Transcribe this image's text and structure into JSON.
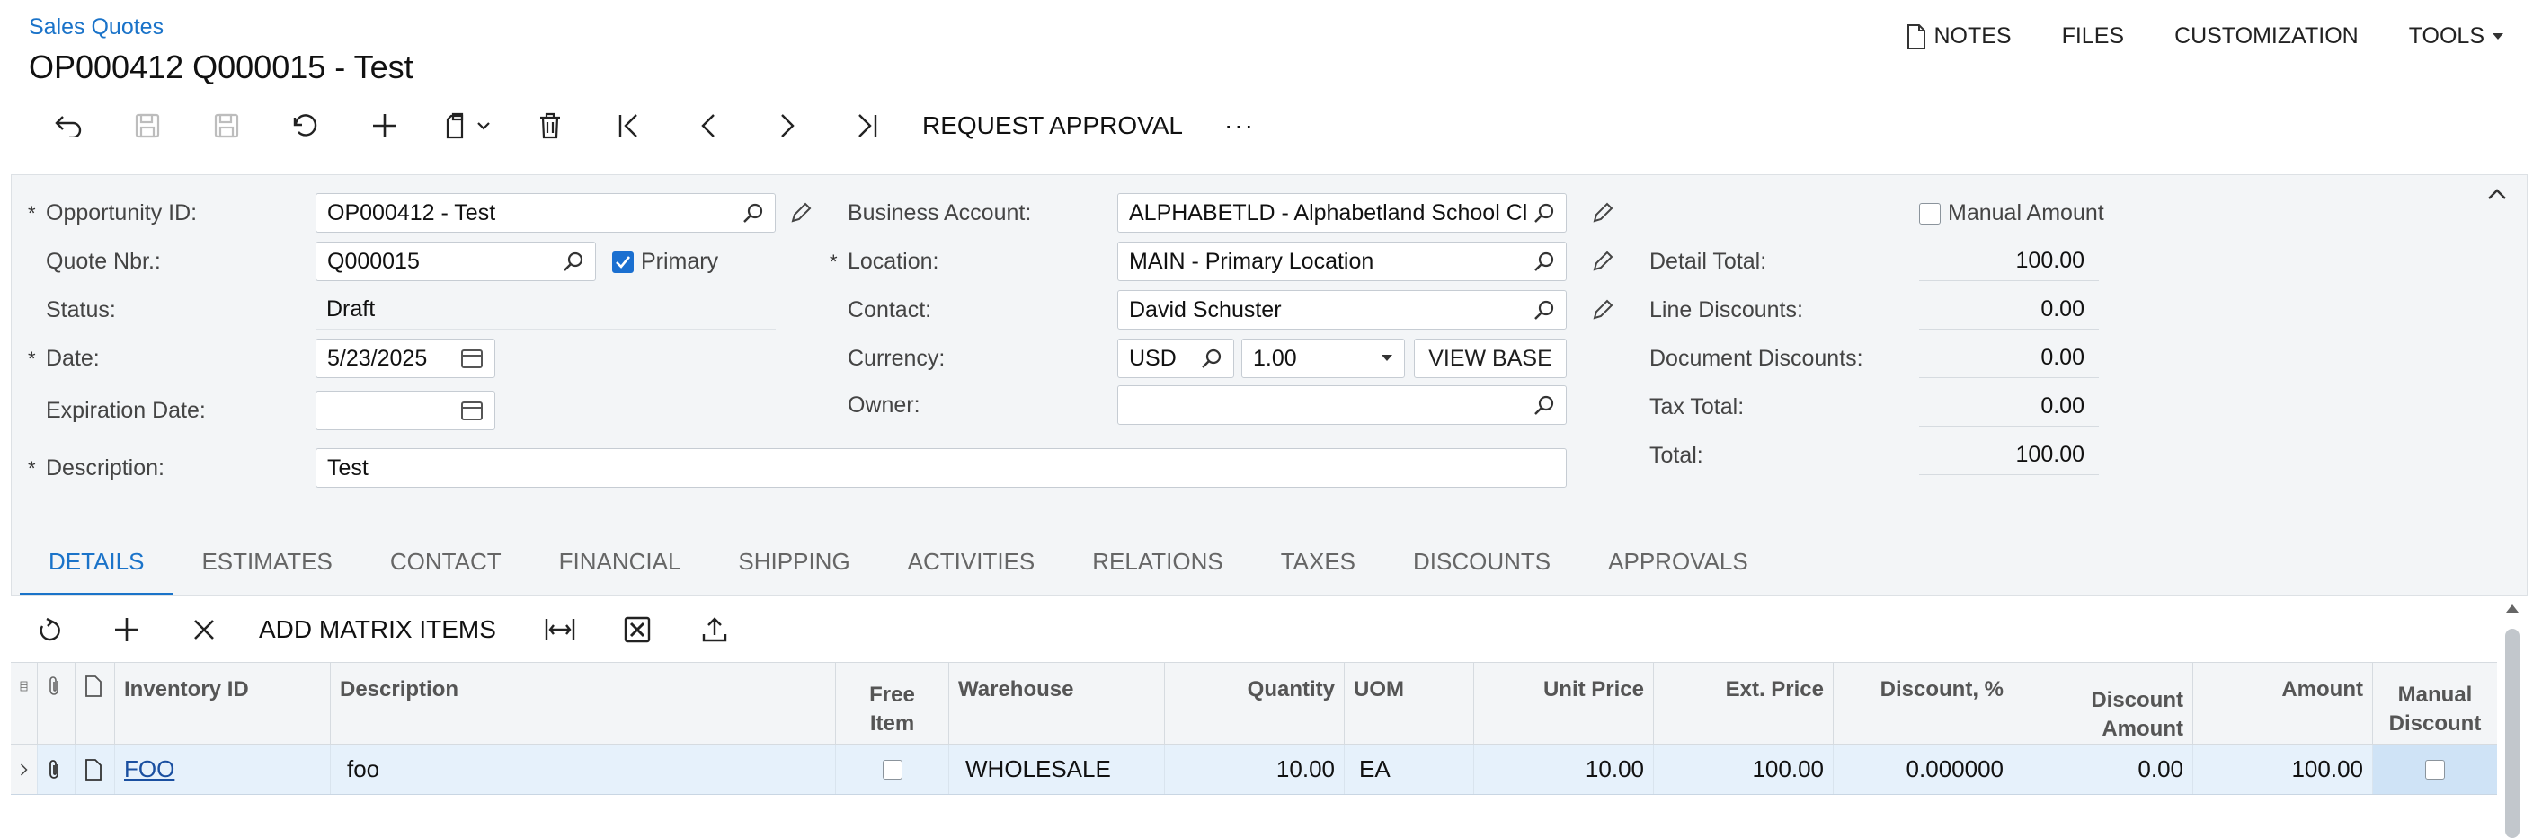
{
  "header": {
    "breadcrumb": "Sales Quotes",
    "title": "OP000412 Q000015 - Test",
    "menu": {
      "notes": "NOTES",
      "files": "FILES",
      "customization": "CUSTOMIZATION",
      "tools": "TOOLS"
    }
  },
  "toolbar": {
    "request_approval": "REQUEST APPROVAL",
    "more": "···"
  },
  "form": {
    "opportunity_id_label": "Opportunity ID:",
    "opportunity_id": "OP000412 - Test",
    "quote_nbr_label": "Quote Nbr.:",
    "quote_nbr": "Q000015",
    "primary_label": "Primary",
    "status_label": "Status:",
    "status": "Draft",
    "date_label": "Date:",
    "date": "5/23/2025",
    "expiration_label": "Expiration Date:",
    "expiration": "",
    "description_label": "Description:",
    "description": "Test",
    "business_account_label": "Business Account:",
    "business_account": "ALPHABETLD - Alphabetland School Cl",
    "location_label": "Location:",
    "location": "MAIN - Primary Location",
    "contact_label": "Contact:",
    "contact": "David Schuster",
    "currency_label": "Currency:",
    "currency": "USD",
    "rate": "1.00",
    "view_base": "VIEW BASE",
    "owner_label": "Owner:",
    "owner": "",
    "manual_amount_label": "Manual Amount",
    "detail_total_label": "Detail Total:",
    "detail_total": "100.00",
    "line_discounts_label": "Line Discounts:",
    "line_discounts": "0.00",
    "document_discounts_label": "Document Discounts:",
    "document_discounts": "0.00",
    "tax_total_label": "Tax Total:",
    "tax_total": "0.00",
    "total_label": "Total:",
    "total": "100.00",
    "required_mark": "*"
  },
  "tabs": [
    "DETAILS",
    "ESTIMATES",
    "CONTACT",
    "FINANCIAL",
    "SHIPPING",
    "ACTIVITIES",
    "RELATIONS",
    "TAXES",
    "DISCOUNTS",
    "APPROVALS"
  ],
  "grid_toolbar": {
    "add_matrix_items": "ADD MATRIX ITEMS"
  },
  "grid": {
    "headers": {
      "inventory_id": "Inventory ID",
      "description": "Description",
      "free_item_1": "Free",
      "free_item_2": "Item",
      "warehouse": "Warehouse",
      "quantity": "Quantity",
      "uom": "UOM",
      "unit_price": "Unit Price",
      "ext_price": "Ext. Price",
      "discount_pct": "Discount, %",
      "discount_amount_1": "Discount",
      "discount_amount_2": "Amount",
      "amount": "Amount",
      "manual_discount_1": "Manual",
      "manual_discount_2": "Discount"
    },
    "rows": [
      {
        "inventory_id": "FOO",
        "description": "foo",
        "warehouse": "WHOLESALE",
        "quantity": "10.00",
        "uom": "EA",
        "unit_price": "10.00",
        "ext_price": "100.00",
        "discount_pct": "0.000000",
        "discount_amount": "0.00",
        "amount": "100.00"
      }
    ]
  }
}
